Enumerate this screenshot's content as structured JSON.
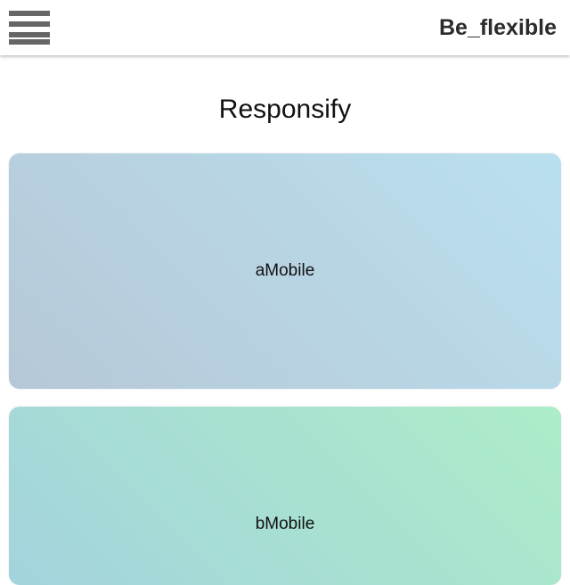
{
  "header": {
    "brand": "Be_flexible",
    "menu_icon": "hamburger-menu-icon"
  },
  "page": {
    "title": "Responsify"
  },
  "cards": [
    {
      "label": "aMobile",
      "gradient_from": "#b6c8d7",
      "gradient_to": "#bae0f0"
    },
    {
      "label": "bMobile",
      "gradient_from": "#a3d3dd",
      "gradient_to": "#adedc8"
    }
  ]
}
